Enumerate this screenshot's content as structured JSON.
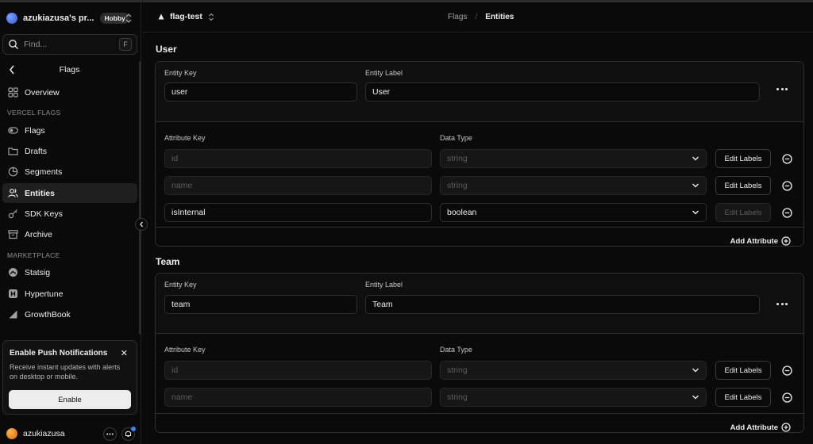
{
  "sidebar": {
    "team_name": "azukiazusa's pr...",
    "team_badge": "Hobby",
    "search_placeholder": "Find...",
    "search_shortcut": "F",
    "back_label": "Flags",
    "overview": "Overview",
    "section_vercel_flags": "VERCEL FLAGS",
    "flags": "Flags",
    "drafts": "Drafts",
    "segments": "Segments",
    "entities": "Entities",
    "sdk_keys": "SDK Keys",
    "archive": "Archive",
    "section_marketplace": "MARKETPLACE",
    "statsig": "Statsig",
    "hypertune": "Hypertune",
    "growthbook": "GrowthBook",
    "toast": {
      "title": "Enable Push Notifications",
      "body": "Receive instant updates with alerts on desktop or mobile.",
      "button": "Enable"
    },
    "user_name": "azukiazusa"
  },
  "header": {
    "project": "flag-test",
    "crumb_parent": "Flags",
    "crumb_current": "Entities"
  },
  "labels": {
    "entity_key": "Entity Key",
    "entity_label": "Entity Label",
    "attribute_key": "Attribute Key",
    "data_type": "Data Type",
    "edit_labels": "Edit Labels",
    "add_attribute": "Add Attribute"
  },
  "entities": [
    {
      "title": "User",
      "key": "user",
      "label": "User",
      "attributes": [
        {
          "key": "id",
          "type": "string"
        },
        {
          "key": "name",
          "type": "string"
        },
        {
          "key": "isInternal",
          "type": "boolean"
        }
      ]
    },
    {
      "title": "Team",
      "key": "team",
      "label": "Team",
      "attributes": [
        {
          "key": "id",
          "type": "string"
        },
        {
          "key": "name",
          "type": "string"
        }
      ]
    }
  ],
  "colors": {
    "background": "#0a0a0a",
    "text": "#ededed",
    "muted": "#a1a1a1",
    "border": "#2e2e2e",
    "notification": "#3b82f6"
  }
}
